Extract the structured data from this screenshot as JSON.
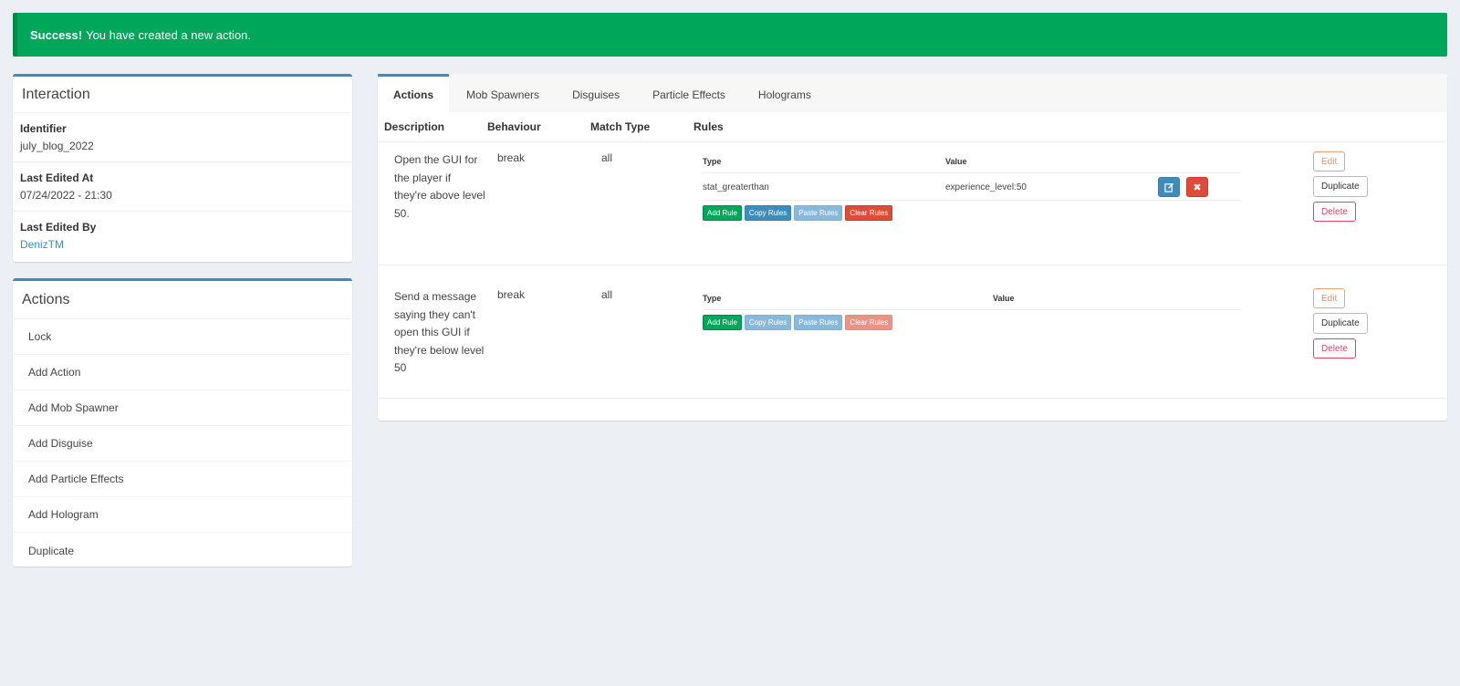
{
  "alert": {
    "strong": "Success!",
    "message": "You have created a new action."
  },
  "interaction": {
    "title": "Interaction",
    "fields": [
      {
        "label": "Identifier",
        "value": "july_blog_2022"
      },
      {
        "label": "Last Edited At",
        "value": "07/24/2022 - 21:30"
      },
      {
        "label": "Last Edited By",
        "value": "DenizTM"
      }
    ]
  },
  "actions_menu": {
    "title": "Actions",
    "items": [
      "Lock",
      "Add Action",
      "Add Mob Spawner",
      "Add Disguise",
      "Add Particle Effects",
      "Add Hologram",
      "Duplicate"
    ]
  },
  "tabs": [
    "Actions",
    "Mob Spawners",
    "Disguises",
    "Particle Effects",
    "Holograms"
  ],
  "table": {
    "headers": {
      "description": "Description",
      "behaviour": "Behaviour",
      "match_type": "Match Type",
      "rules": "Rules"
    },
    "rules_headers": {
      "type": "Type",
      "value": "Value"
    },
    "rule_buttons": {
      "add": "Add Rule",
      "copy": "Copy Rules",
      "paste": "Paste Rules",
      "clear": "Clear Rules"
    },
    "row_buttons": {
      "edit": "Edit",
      "duplicate": "Duplicate",
      "delete": "Delete"
    },
    "rows": [
      {
        "description": "Open the GUI for the player if they're above level 50.",
        "behaviour": "break",
        "match_type": "all",
        "rules": [
          {
            "type": "stat_greaterthan",
            "value": "experience_level:50"
          }
        ]
      },
      {
        "description": "Send a message saying they can't open this GUI if they're below level 50",
        "behaviour": "break",
        "match_type": "all",
        "rules": []
      }
    ]
  },
  "icons": {
    "edit_rule": "edit-icon",
    "remove_rule": "times-icon"
  },
  "colors": {
    "success": "#00a65a",
    "primary": "#3c8dbc",
    "danger": "#dd4b39",
    "warning": "#f08a5d"
  }
}
